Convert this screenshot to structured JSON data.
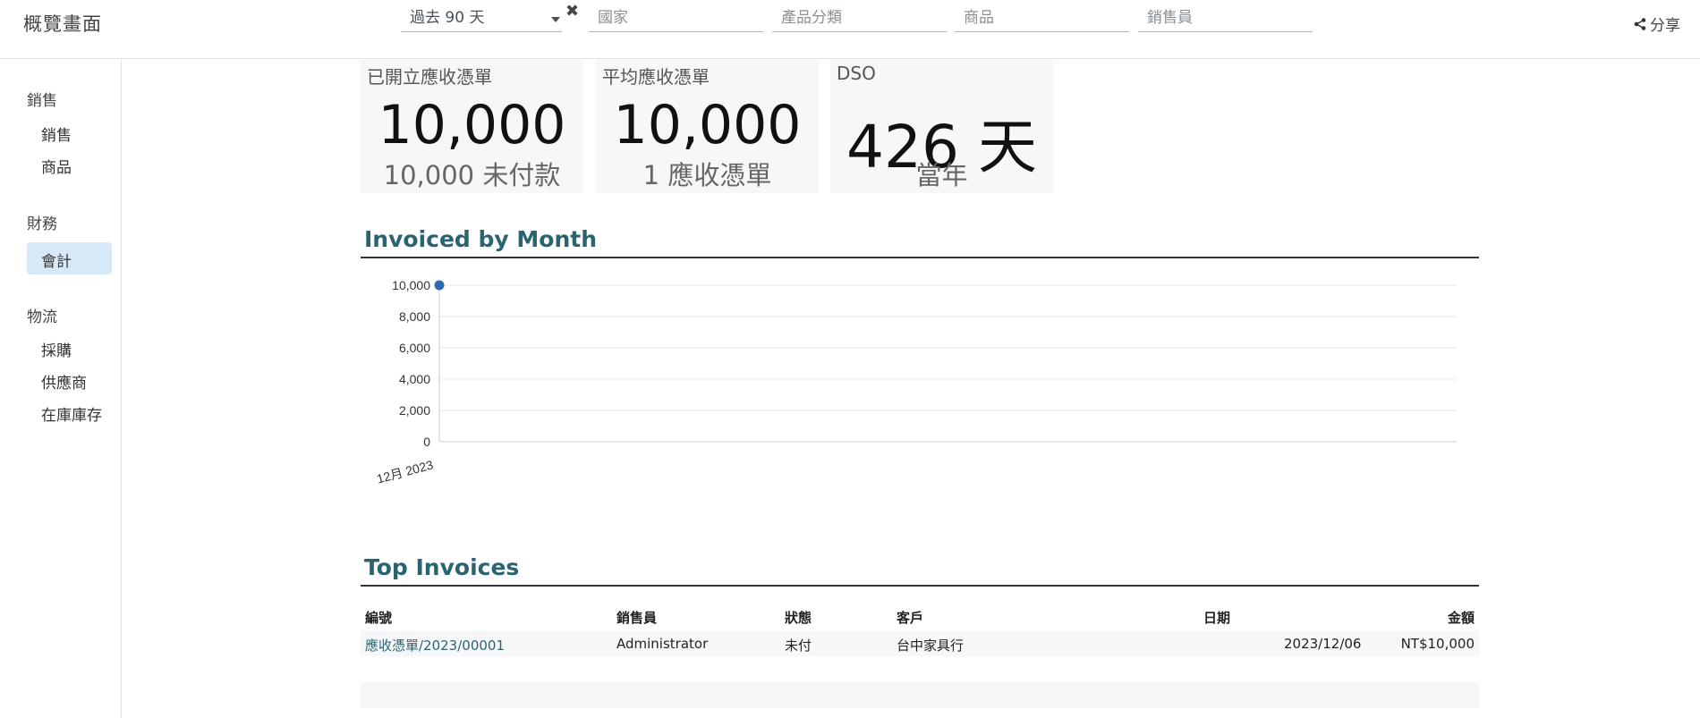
{
  "header": {
    "title": "概覽畫面",
    "filters": {
      "period": "過去 90 天",
      "country_placeholder": "國家",
      "category_placeholder": "產品分類",
      "product_placeholder": "商品",
      "salesperson_placeholder": "銷售員"
    },
    "clear_icon": "close-icon",
    "share_label": "分享",
    "share_icon": "share-icon"
  },
  "sidebar": {
    "sections": [
      {
        "label": "銷售",
        "items": [
          {
            "label": "銷售"
          },
          {
            "label": "商品"
          }
        ]
      },
      {
        "label": "財務",
        "items": [
          {
            "label": "會計",
            "active": true
          }
        ]
      },
      {
        "label": "物流",
        "items": [
          {
            "label": "採購"
          },
          {
            "label": "供應商"
          },
          {
            "label": "在庫庫存"
          }
        ]
      }
    ]
  },
  "kpis": [
    {
      "title": "已開立應收憑單",
      "value": "10,000",
      "sub": "10,000 未付款"
    },
    {
      "title": "平均應收憑單",
      "value": "10,000",
      "sub": "1 應收憑單"
    },
    {
      "title": "DSO",
      "value": "426 天",
      "sub": "當年"
    }
  ],
  "invoiced_by_month": {
    "title": "Invoiced by Month"
  },
  "chart_data": {
    "type": "line",
    "x": [
      "12月 2023"
    ],
    "series": [
      {
        "values": [
          10000
        ]
      }
    ],
    "ylim": [
      0,
      10000
    ],
    "yticks": [
      "10,000",
      "8,000",
      "6,000",
      "4,000",
      "2,000",
      "0"
    ],
    "ytick_values": [
      10000,
      8000,
      6000,
      4000,
      2000,
      0
    ],
    "grid": true,
    "color": "#2b6cb0"
  },
  "top_invoices": {
    "title": "Top Invoices",
    "columns": [
      "編號",
      "銷售員",
      "狀態",
      "客戶",
      "日期",
      "金額"
    ],
    "rows": [
      {
        "number": "應收憑單/2023/00001",
        "salesperson": "Administrator",
        "status": "未付",
        "customer": "台中家具行",
        "date": "2023/12/06",
        "amount": "NT$10,000"
      }
    ]
  }
}
